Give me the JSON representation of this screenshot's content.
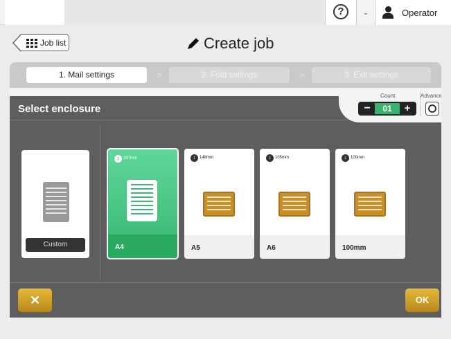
{
  "topbar": {
    "help_symbol": "?",
    "dropdown_caret": "⌄",
    "user_label": "Operator"
  },
  "header": {
    "back_label": "Job list",
    "title": "Create job"
  },
  "steps": [
    {
      "label": "1. Mail settings",
      "active": true
    },
    {
      "label": "2. Fold settings",
      "active": false
    },
    {
      "label": "3. Exit settings",
      "active": false
    }
  ],
  "panel": {
    "title": "Select enclosure",
    "count_label": "Count",
    "count_value": "01",
    "count_minus": "−",
    "count_plus": "+",
    "advanced_label": "Advanced"
  },
  "enclosures": {
    "custom": {
      "label": "Custom"
    },
    "a4": {
      "name": "A4",
      "size": "297mm",
      "selected": true
    },
    "a5": {
      "name": "A5",
      "size": "148mm",
      "selected": false
    },
    "a6": {
      "name": "A6",
      "size": "105mm",
      "selected": false
    },
    "size100": {
      "name": "100mm",
      "size": "100mm",
      "selected": false
    }
  },
  "actions": {
    "cancel_symbol": "✕",
    "ok_label": "OK"
  },
  "colors": {
    "accent_green": "#35b46a",
    "accent_gold": "#c8902a",
    "panel_bg": "#5e5e5e"
  }
}
